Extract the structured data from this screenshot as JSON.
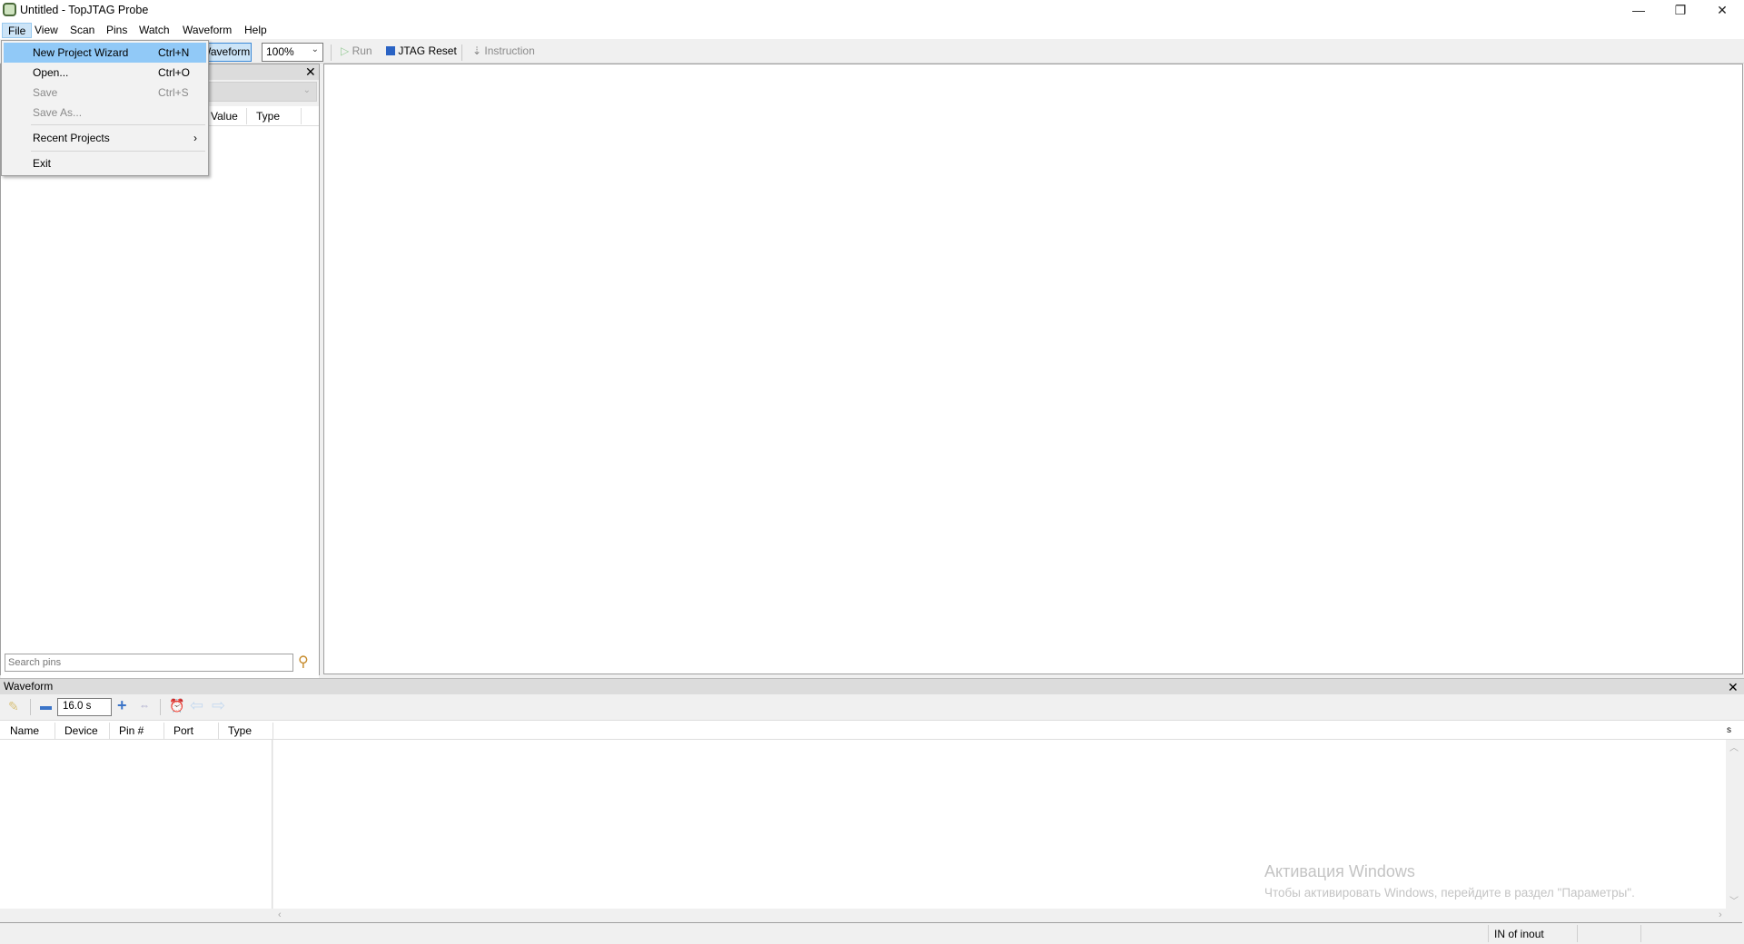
{
  "window": {
    "title": "Untitled - TopJTAG Probe",
    "controls": {
      "minimize": "—",
      "restore": "❐",
      "close": "✕"
    }
  },
  "menubar": [
    "File",
    "View",
    "Scan",
    "Pins",
    "Watch",
    "Waveform",
    "Help"
  ],
  "file_menu": {
    "items": [
      {
        "label": "New Project Wizard",
        "shortcut": "Ctrl+N",
        "enabled": true,
        "highlighted": true
      },
      {
        "label": "Open...",
        "shortcut": "Ctrl+O",
        "enabled": true
      },
      {
        "label": "Save",
        "shortcut": "Ctrl+S",
        "enabled": false
      },
      {
        "label": "Save As...",
        "shortcut": "",
        "enabled": false
      },
      {
        "label": "Recent Projects",
        "submenu": "›",
        "enabled": true
      },
      {
        "label": "Exit",
        "shortcut": "",
        "enabled": true
      }
    ]
  },
  "toolbar": {
    "waveform_label": "Waveform",
    "zoom": "100%",
    "run": "Run",
    "jtag_reset": "JTAG Reset",
    "instruction": "Instruction"
  },
  "pins_panel": {
    "close": "✕",
    "columns": [
      "Value",
      "Type"
    ],
    "search_placeholder": "Search pins"
  },
  "waveform_panel": {
    "title": "Waveform",
    "close": "✕",
    "time_scale": "16.0 s",
    "columns": [
      "Name",
      "Device",
      "Pin #",
      "Port",
      "Type"
    ],
    "time_unit": "s"
  },
  "status": {
    "text": "IN of inout"
  },
  "watermark": {
    "line1": "Активация Windows",
    "line2": "Чтобы активировать Windows, перейдите в раздел \"Параметры\"."
  }
}
